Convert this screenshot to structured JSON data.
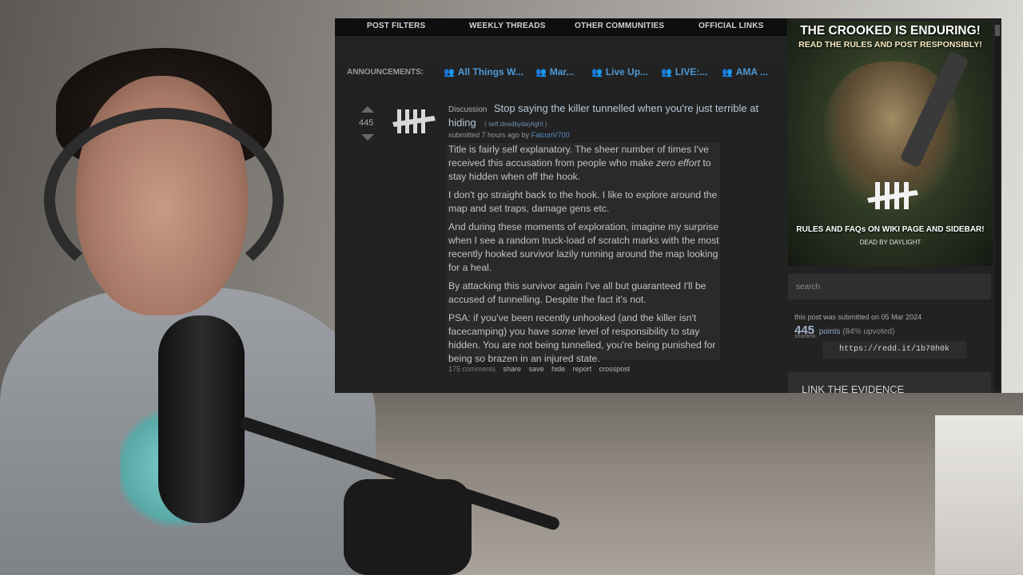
{
  "nav": {
    "items": [
      "POST FILTERS",
      "WEEKLY THREADS",
      "OTHER COMMUNITIES",
      "OFFICIAL LINKS"
    ]
  },
  "announcements": {
    "label": "ANNOUNCEMENTS:",
    "items": [
      "All Things W...",
      "Mar...",
      "Live Up...",
      "LIVE:...",
      "AMA ..."
    ]
  },
  "post": {
    "score": "445",
    "flair": "Discussion",
    "title": "Stop saying the killer tunnelled when you're just terrible at hiding",
    "domain": "( self.deadbydaylight )",
    "tagline_prefix": "submitted 7 hours ago by",
    "author": "FalconV700",
    "body": {
      "p1_a": "Title is fairly self explanatory. The sheer number of times I've received this accusation from people who make ",
      "p1_em": "zero effort",
      "p1_b": " to stay hidden when off the hook.",
      "p2": "I don't go straight back to the hook. I like to explore around the map and set traps, damage gens etc.",
      "p3": "And during these moments of exploration, imagine my surprise when I see a random truck-load of scratch marks with the most recently hooked survivor lazily running around the map looking for a heal.",
      "p4": "By attacking this survivor again I've all but guaranteed I'll be accused of tunnelling. Despite the fact it's not.",
      "p5_a": "PSA: if you've been recently unhooked (and the killer isn't facecamping) you have ",
      "p5_em": "some",
      "p5_b": " level of responsibility to stay hidden. You are not being tunnelled, you're being punished for being so brazen in an injured state."
    },
    "buttons": {
      "comments": "175 comments",
      "share": "share",
      "save": "save",
      "hide": "hide",
      "report": "report",
      "crosspost": "crosspost"
    }
  },
  "sidebar": {
    "banner": {
      "headline": "THE CROOKED IS ENDURING!",
      "subline": "READ THE RULES AND POST RESPONSIBLY!",
      "rules": "RULES AND FAQs ON WIKI PAGE AND SIDEBAR!",
      "game": "DEAD BY DAYLIGHT"
    },
    "search_placeholder": "search",
    "submitted_on": "this post was submitted on 05 Mar 2024",
    "points_num": "445",
    "points_label": "points",
    "upvoted": "(84% upvoted)",
    "shortlink_label": "shortlink:",
    "shortlink": "https://redd.it/1b70h0k",
    "evidence": "LINK THE EVIDENCE"
  },
  "colors": {
    "link": "#4e9ad6",
    "announcement_icon": "#3fb84a",
    "background": "#222222"
  }
}
